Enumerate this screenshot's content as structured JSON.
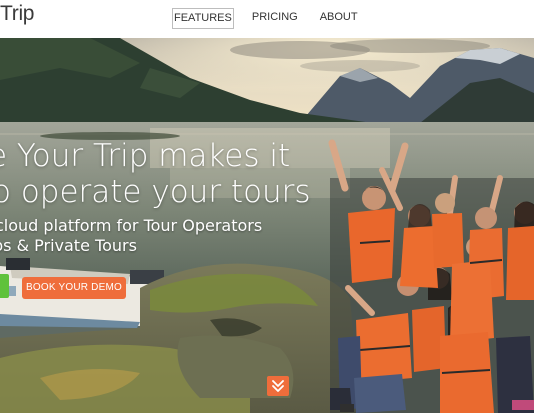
{
  "header": {
    "logo_text": "Trip",
    "nav": [
      {
        "label": "FEATURES",
        "active": true
      },
      {
        "label": "PRICING",
        "active": false
      },
      {
        "label": "ABOUT",
        "active": false
      }
    ]
  },
  "hero": {
    "headline_line1": "e Your Trip makes it",
    "headline_line2": "o operate your tours",
    "subline_line1": "cloud platform for Tour Operators",
    "subline_line2": "ps & Private Tours",
    "cta_label": "BOOK YOUR DEMO",
    "scroll_icon": "double-chevron-down-icon"
  },
  "colors": {
    "accent": "#ef6d3b",
    "side_tab": "#5fc23b",
    "text_dark": "#333333"
  }
}
